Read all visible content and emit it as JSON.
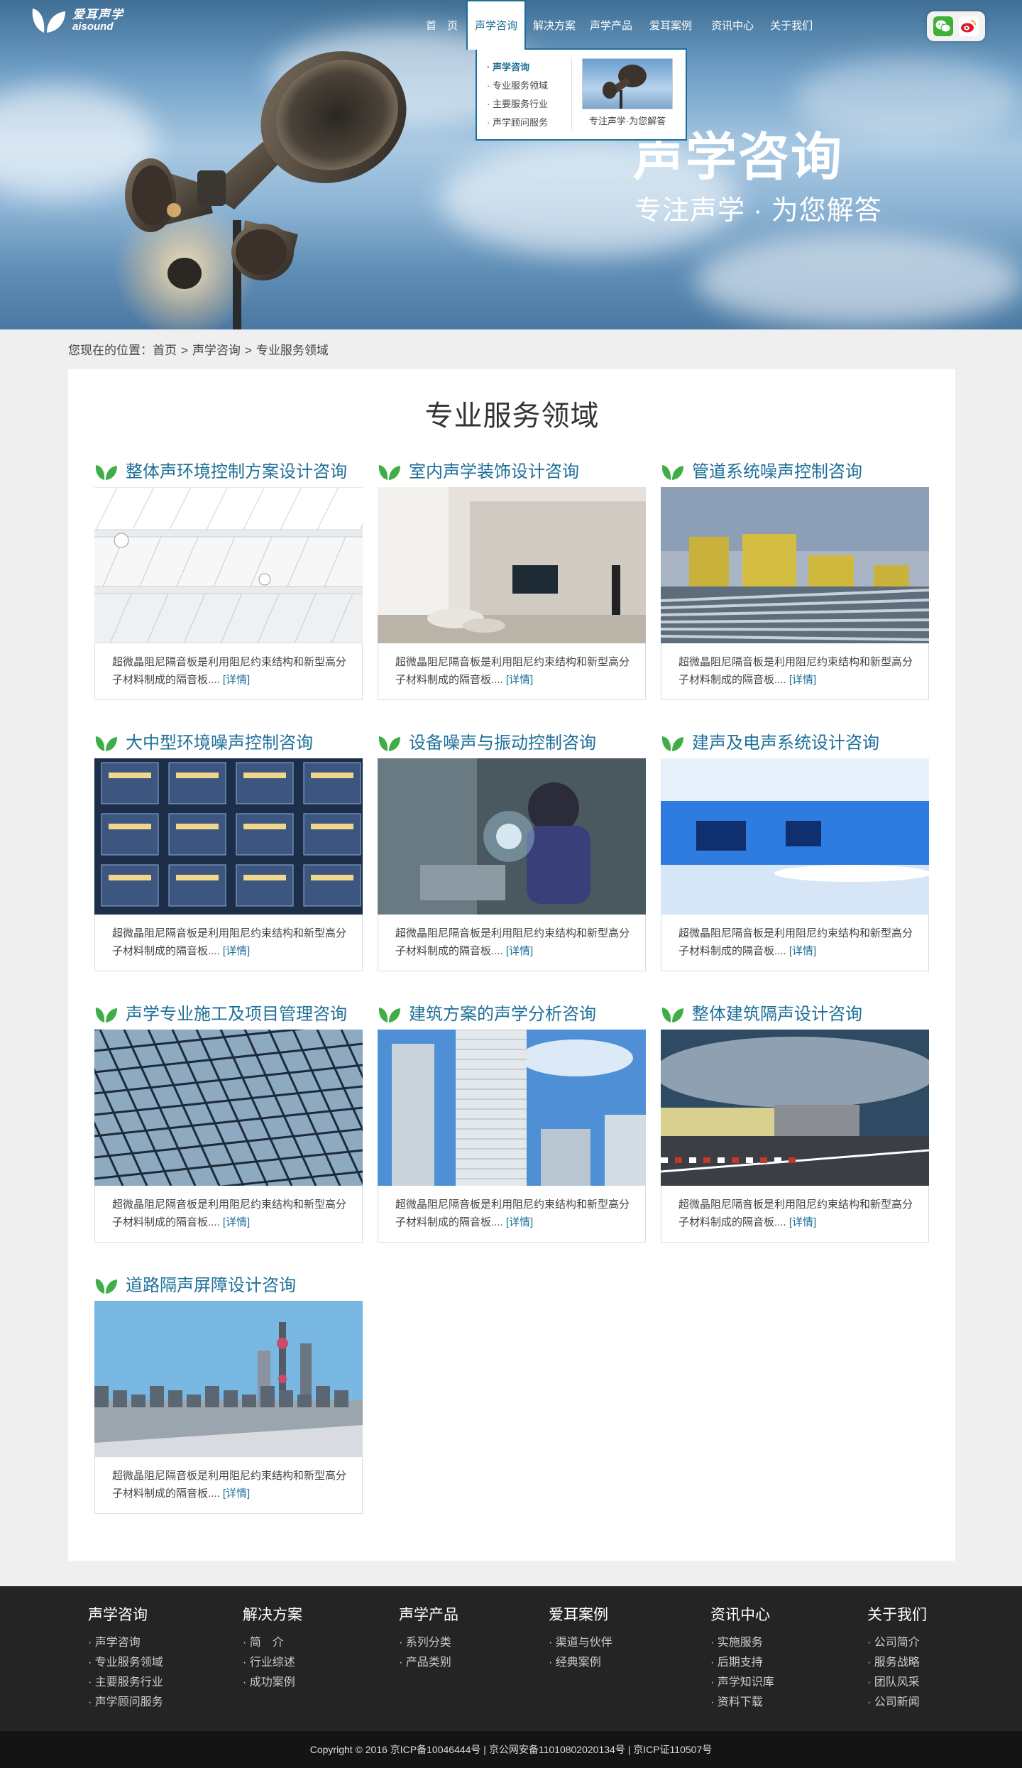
{
  "logo": {
    "cn": "爱耳声学",
    "en": "aisound"
  },
  "nav": {
    "items": [
      {
        "label": "首　页"
      },
      {
        "label": "声学咨询"
      },
      {
        "label": "解决方案"
      },
      {
        "label": "声学产品"
      },
      {
        "label": "爱耳案例"
      },
      {
        "label": "资讯中心"
      },
      {
        "label": "关于我们"
      }
    ],
    "dropdown": {
      "items": [
        "声学咨询",
        "专业服务领域",
        "主要服务行业",
        "声学顾问服务"
      ],
      "caption": "专注声学·为您解答"
    }
  },
  "hero": {
    "title": "声学咨询",
    "subtitle": "专注声学 · 为您解答"
  },
  "breadcrumb": {
    "prefix": "您现在的位置：",
    "items": [
      "首页",
      "声学咨询",
      "专业服务领域"
    ],
    "sep": ">"
  },
  "main": {
    "title": "专业服务领域",
    "desc": "超微晶阻尼隔音板是利用阻尼约束结构和新型高分子材料制成的隔音板....",
    "more": "[详情]",
    "cards": [
      {
        "title": "整体声环境控制方案设计咨询"
      },
      {
        "title": "室内声学装饰设计咨询"
      },
      {
        "title": "管道系统噪声控制咨询"
      },
      {
        "title": "大中型环境噪声控制咨询"
      },
      {
        "title": "设备噪声与振动控制咨询"
      },
      {
        "title": "建声及电声系统设计咨询"
      },
      {
        "title": "声学专业施工及项目管理咨询"
      },
      {
        "title": "建筑方案的声学分析咨询"
      },
      {
        "title": "整体建筑隔声设计咨询"
      },
      {
        "title": "道路隔声屏障设计咨询"
      }
    ]
  },
  "footer": {
    "columns": [
      {
        "title": "声学咨询",
        "items": [
          "声学咨询",
          "专业服务领域",
          "主要服务行业",
          "声学顾问服务"
        ]
      },
      {
        "title": "解决方案",
        "items": [
          "简　介",
          "行业综述",
          "成功案例"
        ]
      },
      {
        "title": "声学产品",
        "items": [
          "系列分类",
          "产品类别"
        ]
      },
      {
        "title": "爱耳案例",
        "items": [
          "渠道与伙伴",
          "经典案例"
        ]
      },
      {
        "title": "资讯中心",
        "items": [
          "实施服务",
          "后期支持",
          "声学知识库",
          "资料下载"
        ]
      },
      {
        "title": "关于我们",
        "items": [
          "公司简介",
          "服务战略",
          "团队风采",
          "公司新闻"
        ]
      }
    ],
    "copyright": "Copyright © 2016  京ICP备10046444号 | 京公网安备11010802020134号 | 京ICP证110507号"
  },
  "colors": {
    "accent": "#1d6f98",
    "leaf": "#3fae49",
    "footer_bg": "#242424",
    "copyright_bg": "#141414",
    "page_bg": "#efefef"
  },
  "icons": {
    "logo": "leaf-logo-icon",
    "card_head": "green-leaf-icon",
    "wechat": "wechat-icon",
    "weibo": "weibo-icon"
  }
}
